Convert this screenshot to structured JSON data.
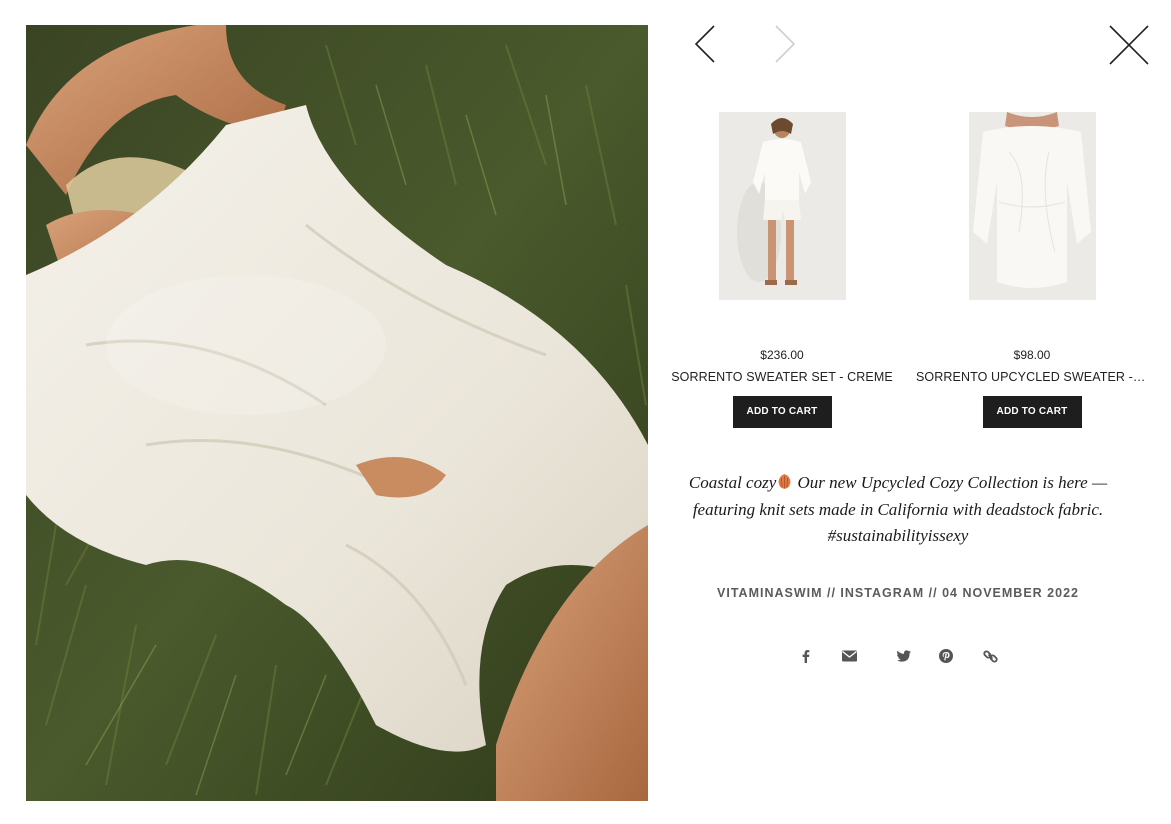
{
  "colors": {
    "text": "#222222",
    "button_bg": "#1e1e1e",
    "button_text": "#ffffff",
    "meta_text": "#5b5b5b",
    "icon": "#555555"
  },
  "navigation": {
    "prev_icon": "chevron-left-icon",
    "next_icon": "chevron-right-icon",
    "close_icon": "close-icon"
  },
  "products": [
    {
      "price": "$236.00",
      "name": "SORRENTO SWEATER SET - CREME",
      "button_label": "ADD TO CART"
    },
    {
      "price": "$98.00",
      "name": "SORRENTO UPCYCLED SWEATER - CREME",
      "button_label": "ADD TO CART"
    }
  ],
  "caption": {
    "part1": "Coastal cozy",
    "part2": " Our new Upcycled Cozy Collection is here — featuring knit sets made in California with deadstock fabric. #sustainabilityissexy"
  },
  "meta": {
    "source": "VITAMINASWIM // INSTAGRAM // 04 NOVEMBER 2022"
  },
  "share_icons": [
    "facebook-icon",
    "envelope-icon",
    "twitter-icon",
    "pinterest-icon",
    "link-icon"
  ]
}
